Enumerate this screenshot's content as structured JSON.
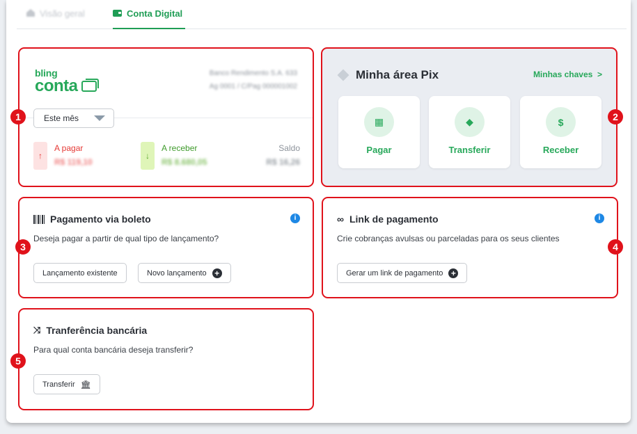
{
  "tabs": [
    {
      "label": "Visão geral",
      "active": false
    },
    {
      "label": "Conta Digital",
      "active": true
    }
  ],
  "account": {
    "logo_top": "bling",
    "logo_bottom": "conta",
    "bank_name": "Banco Rendimento S.A. 633",
    "bank_details": "Ag 0001 / C/Pag 000001002",
    "period_label": "Este mês",
    "to_pay_label": "A pagar",
    "to_pay_value": "R$ 119,10",
    "to_receive_label": "A receber",
    "to_receive_value": "R$ 8.680,05",
    "balance_label": "Saldo",
    "balance_value": "R$ 16,26"
  },
  "pix": {
    "title": "Minha área Pix",
    "keys_link": "Minhas chaves",
    "actions": [
      {
        "label": "Pagar",
        "icon": "qr-code-icon"
      },
      {
        "label": "Transferir",
        "icon": "pix-diamond-icon"
      },
      {
        "label": "Receber",
        "icon": "receive-money-icon"
      }
    ]
  },
  "boleto": {
    "title": "Pagamento via boleto",
    "description": "Deseja pagar a partir de qual tipo de lançamento?",
    "existing_button": "Lançamento existente",
    "new_button": "Novo lançamento"
  },
  "payment_link": {
    "title": "Link de pagamento",
    "description": "Crie cobranças avulsas ou parceladas para os seus clientes",
    "button": "Gerar um link de pagamento"
  },
  "transfer": {
    "title": "Tranferência bancária",
    "description": "Para qual conta bancária deseja transferir?",
    "button": "Transferir"
  },
  "markers": [
    "1",
    "2",
    "3",
    "4",
    "5"
  ],
  "colors": {
    "brand_green": "#27a85a",
    "highlight_red": "#e0121b",
    "info_blue": "#1e88e5"
  }
}
